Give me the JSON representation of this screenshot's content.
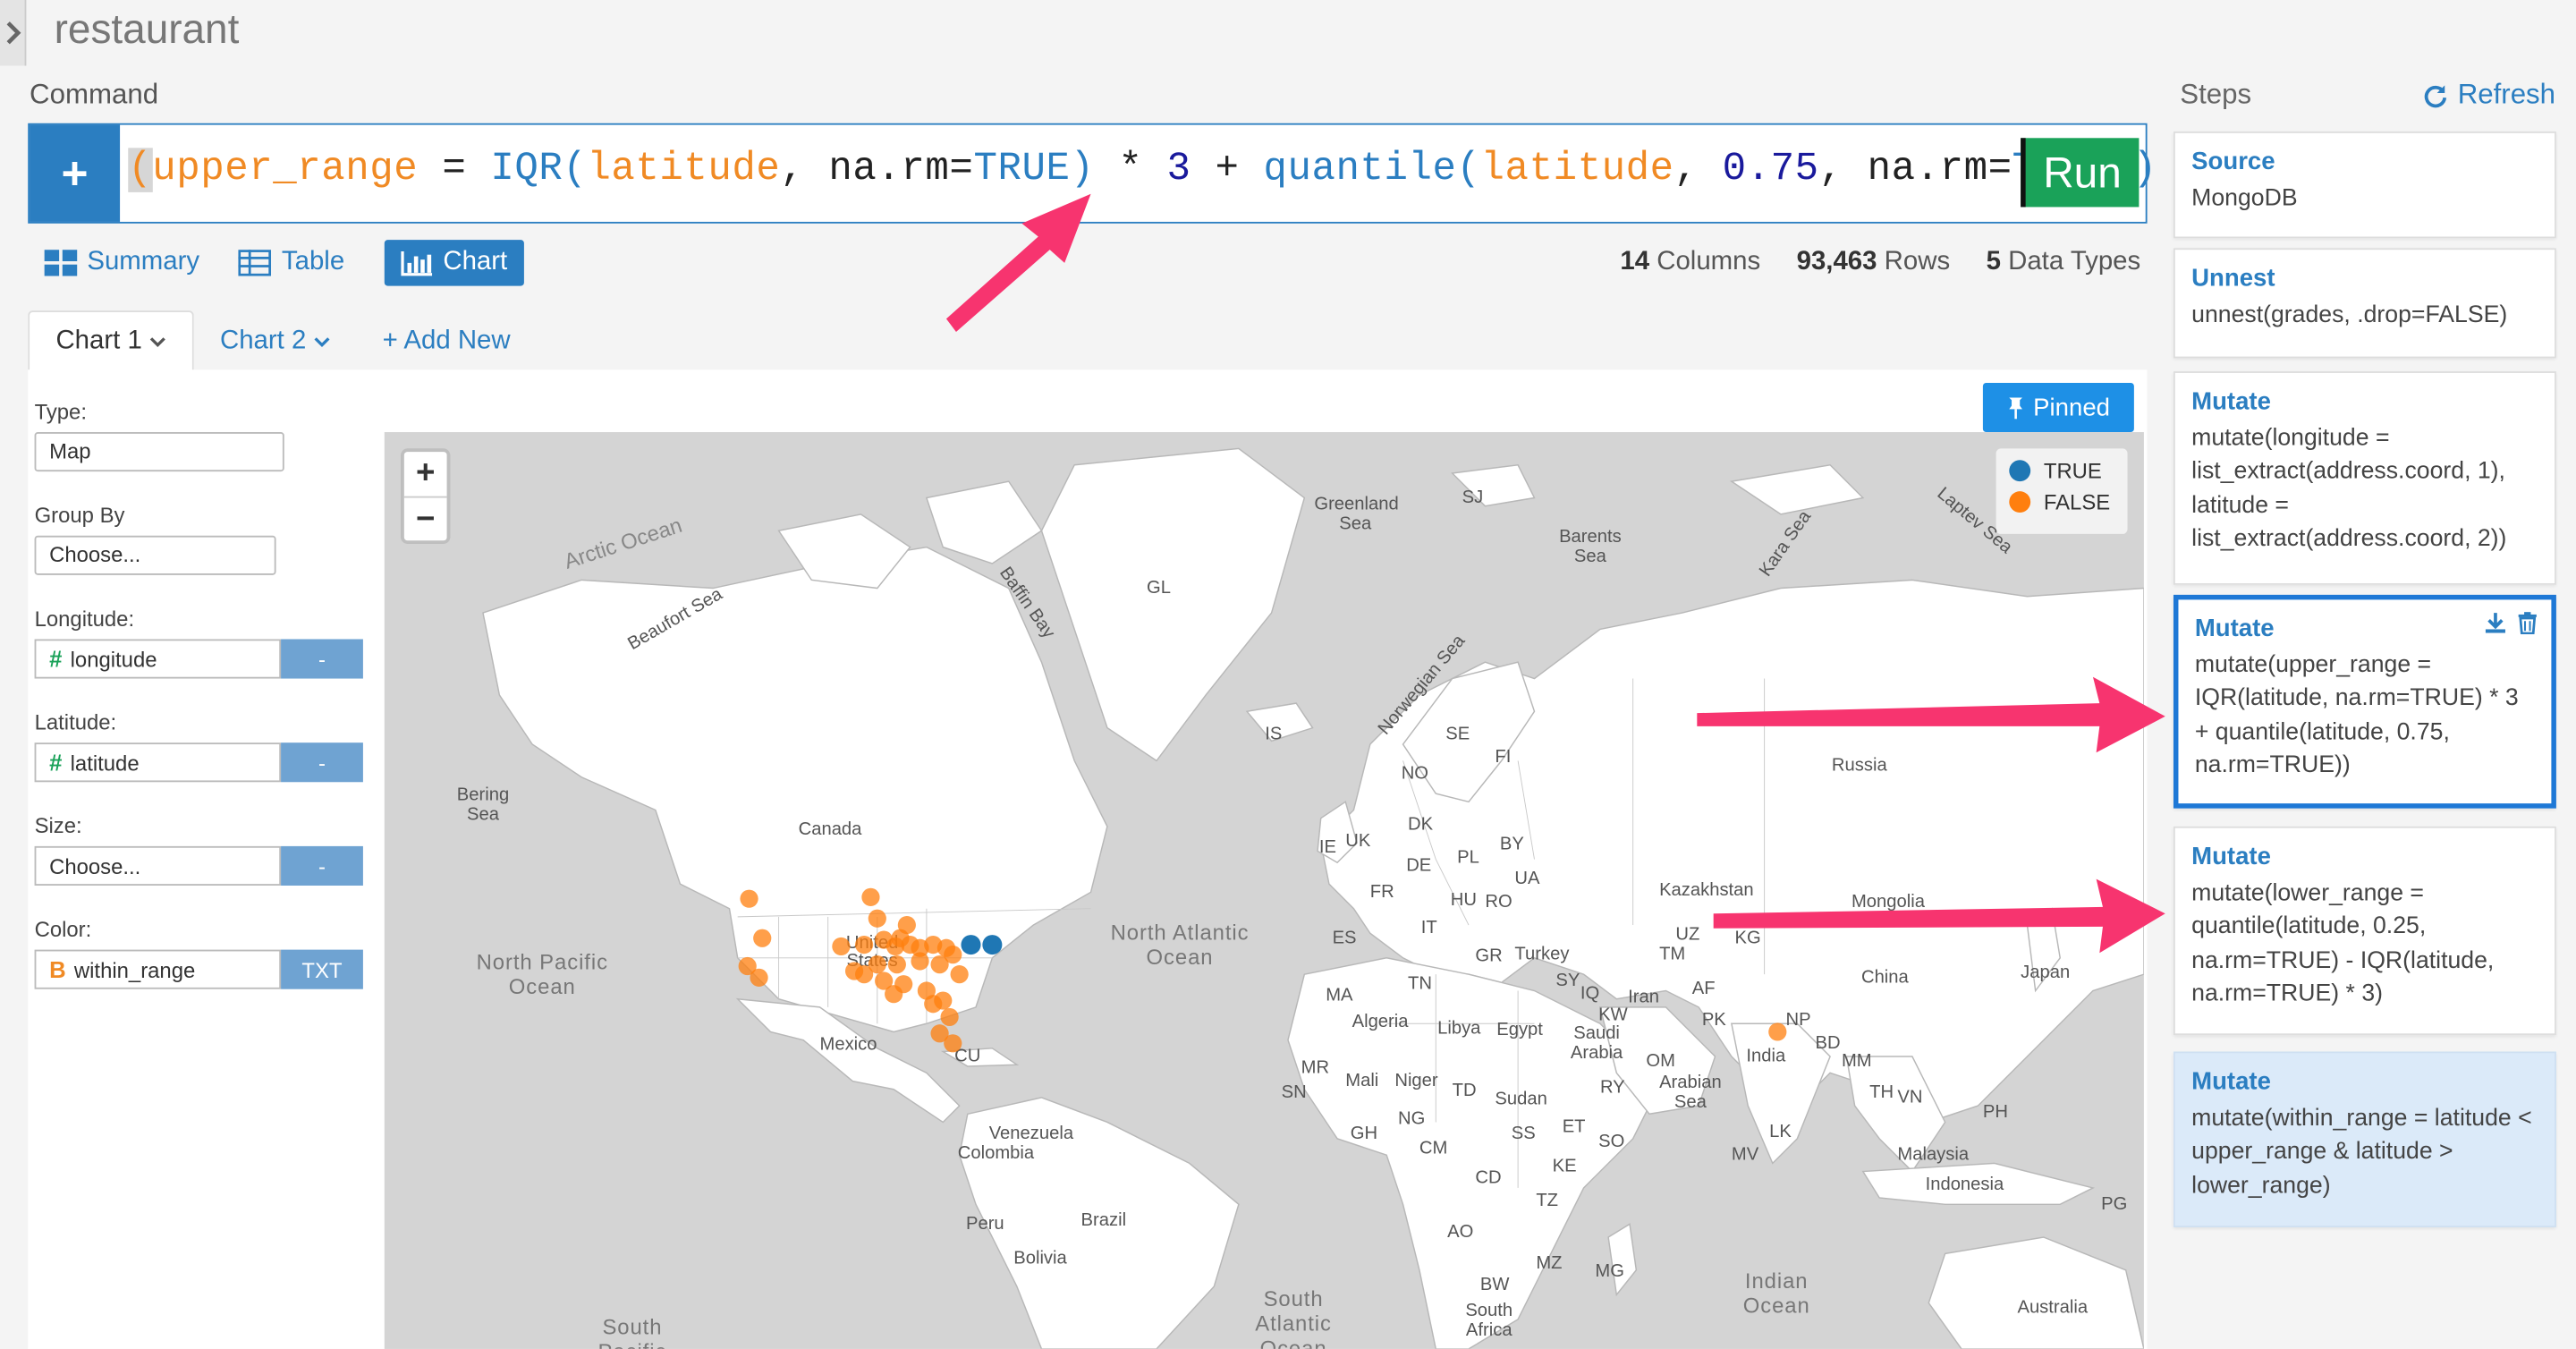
{
  "app": {
    "title": "restaurant"
  },
  "command": {
    "label": "Command",
    "tokens": [
      {
        "t": "(",
        "cls": "paren-hl"
      },
      {
        "t": "upper_range",
        "cls": "c-orange"
      },
      {
        "t": " = ",
        "cls": "c-dark"
      },
      {
        "t": "IQR(",
        "cls": "c-blue"
      },
      {
        "t": "latitude",
        "cls": "c-orange"
      },
      {
        "t": ", ",
        "cls": "c-dark"
      },
      {
        "t": "na.rm=",
        "cls": "c-dark"
      },
      {
        "t": "TRUE",
        "cls": "c-blue"
      },
      {
        "t": ")",
        "cls": "c-blue"
      },
      {
        "t": " * ",
        "cls": "c-dark"
      },
      {
        "t": "3",
        "cls": "c-num"
      },
      {
        "t": " + ",
        "cls": "c-dark"
      },
      {
        "t": "quantile(",
        "cls": "c-blue"
      },
      {
        "t": "latitude",
        "cls": "c-orange"
      },
      {
        "t": ", ",
        "cls": "c-dark"
      },
      {
        "t": "0.75",
        "cls": "c-num"
      },
      {
        "t": ", ",
        "cls": "c-dark"
      },
      {
        "t": "na.rm=",
        "cls": "c-dark"
      },
      {
        "t": "TRUE",
        "cls": "c-blue"
      },
      {
        "t": "))",
        "cls": "c-blue"
      }
    ],
    "run_label": "Run",
    "add_label": "+"
  },
  "view_tabs": [
    {
      "label": "Summary",
      "icon": "summary-icon"
    },
    {
      "label": "Table",
      "icon": "table-icon"
    },
    {
      "label": "Chart",
      "icon": "chart-icon",
      "active": true
    }
  ],
  "stats": {
    "columns": "14",
    "columns_label": "Columns",
    "rows": "93,463",
    "rows_label": "Rows",
    "types": "5",
    "types_label": "Data Types"
  },
  "chart_tabs": {
    "tab1": "Chart 1",
    "tab2": "Chart 2",
    "add": "+ Add New"
  },
  "config": {
    "type_label": "Type:",
    "type_value": "Map",
    "group_label": "Group By",
    "group_value": "Choose...",
    "lon_label": "Longitude:",
    "lon_value": "longitude",
    "lon_btn": "-",
    "lat_label": "Latitude:",
    "lat_value": "latitude",
    "lat_btn": "-",
    "size_label": "Size:",
    "size_value": "Choose...",
    "size_btn": "-",
    "color_label": "Color:",
    "color_value": "within_range",
    "color_btn": "TXT",
    "num_symbol": "#",
    "bool_symbol": "B"
  },
  "pinned_label": "Pinned",
  "map": {
    "zoom_in": "+",
    "zoom_out": "−",
    "legend": [
      {
        "label": "TRUE",
        "color": "#1f77b4"
      },
      {
        "label": "FALSE",
        "color": "#ff7f0e"
      }
    ],
    "labels": {
      "arctic": "Arctic Ocean",
      "greenland_sea": "Greenland Sea",
      "barents": "Barents Sea",
      "kara": "Kara Sea",
      "laptev": "Laptev Sea",
      "sj": "SJ",
      "gl": "GL",
      "baffin": "Baffin Bay",
      "beaufort": "Beaufort Sea",
      "norwegian": "Norwegian Sea",
      "is": "IS",
      "bering": "Bering Sea",
      "canada": "Canada",
      "russia": "Russia",
      "se": "SE",
      "fi": "FI",
      "no": "NO",
      "dk": "DK",
      "ie": "IE",
      "uk": "UK",
      "de": "DE",
      "pl": "PL",
      "by": "BY",
      "ua": "UA",
      "fr": "FR",
      "hu": "HU",
      "ro": "RO",
      "it": "IT",
      "es": "ES",
      "gr": "GR",
      "turkey": "Turkey",
      "kazakhstan": "Kazakhstan",
      "mongolia": "Mongolia",
      "uz": "UZ",
      "kg": "KG",
      "tm": "TM",
      "af": "AF",
      "pk": "PK",
      "np": "NP",
      "bd": "BD",
      "mm": "MM",
      "china": "China",
      "japan": "Japan",
      "india": "India",
      "th": "TH",
      "vn": "VN",
      "ph": "PH",
      "malaysia": "Malaysia",
      "indonesia": "Indonesia",
      "pg": "PG",
      "australia": "Australia",
      "sy": "SY",
      "iq": "IQ",
      "iran": "Iran",
      "kw": "KW",
      "saudi": "Saudi\nArabia",
      "om": "OM",
      "ye": "RY",
      "arabian_sea": "Arabian\nSea",
      "tn": "TN",
      "ma": "MA",
      "algeria": "Algeria",
      "libya": "Libya",
      "egypt": "Egypt",
      "mr": "MR",
      "mali": "Mali",
      "niger": "Niger",
      "td": "TD",
      "sudan": "Sudan",
      "sn": "SN",
      "ng": "NG",
      "gh": "GH",
      "ss": "SS",
      "et": "ET",
      "so": "SO",
      "cm": "CM",
      "ke": "KE",
      "cd": "CD",
      "tz": "TZ",
      "ao": "AO",
      "mz": "MZ",
      "mg": "MG",
      "bw": "BW",
      "south_africa": "South\nAfrica",
      "lk": "LK",
      "mv": "MV",
      "united_states": "United\nStates",
      "mexico": "Mexico",
      "cu": "CU",
      "venezuela": "Venezuela",
      "colombia": "Colombia",
      "peru": "Peru",
      "brazil": "Brazil",
      "bolivia": "Bolivia",
      "north_pacific": "North Pacific\nOcean",
      "north_atlantic": "North Atlantic\nOcean",
      "south_atlantic": "South\nAtlantic\nOcean",
      "indian": "Indian\nOcean",
      "south": "South\nPacific"
    }
  },
  "steps": {
    "title": "Steps",
    "refresh": "Refresh",
    "items": [
      {
        "name": "Source",
        "body": "MongoDB"
      },
      {
        "name": "Unnest",
        "body": "unnest(grades, .drop=FALSE)"
      },
      {
        "name": "Mutate",
        "body": "mutate(longitude = list_extract(address.coord, 1), latitude = list_extract(address.coord, 2))"
      },
      {
        "name": "Mutate",
        "body": "mutate(upper_range = IQR(latitude, na.rm=TRUE) * 3 + quantile(latitude, 0.75, na.rm=TRUE))"
      },
      {
        "name": "Mutate",
        "body": "mutate(lower_range = quantile(latitude, 0.25, na.rm=TRUE) - IQR(latitude, na.rm=TRUE) * 3)"
      },
      {
        "name": "Mutate",
        "body": "mutate(within_range = latitude < upper_range & latitude > lower_range)"
      }
    ]
  }
}
